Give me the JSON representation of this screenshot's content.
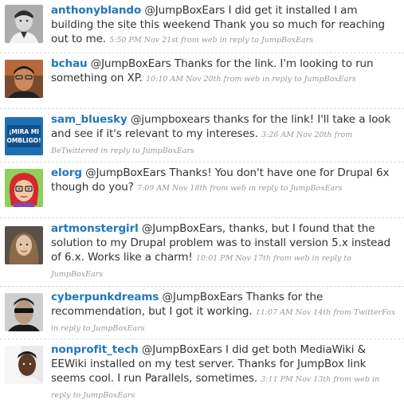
{
  "tweets": [
    {
      "username": "anthonyblando",
      "text": "@JumpBoxEars I did get it installed I am building the site this weekend Thank you so much for reaching out to me.",
      "time": "5:50 PM Nov 21st",
      "source": "from web",
      "reply": "in reply to JumpBoxEars",
      "avatar_icon": "grayscale-portrait-icon"
    },
    {
      "username": "bchau",
      "text": "@JumpBoxEars Thanks for the link. I'm looking to run something on XP.",
      "time": "10:10 AM Nov 20th",
      "source": "from web",
      "reply": "in reply to JumpBoxEars",
      "avatar_icon": "portrait-icon"
    },
    {
      "username": "sam_bluesky",
      "text": "@jumpboxears thanks for the link! I'll take a look and see if it's relevant to my intereses.",
      "time": "3:26 AM Nov 20th",
      "source": "from BeTwittered",
      "reply": "in reply to JumpBoxEars",
      "avatar_icon": "text-badge-icon",
      "avatar_text": [
        "¡MIRA MI",
        "OMBLIGO!"
      ]
    },
    {
      "username": "elorg",
      "text": "@JumpBoxEars Thanks! You don't have one for Drupal 6x though do you?",
      "time": "7:09 AM Nov 18th",
      "source": "from web",
      "reply": "in reply to JumpBoxEars",
      "avatar_icon": "cartoon-avatar-icon"
    },
    {
      "username": "artmonstergirl",
      "text": "@JumpBoxEars, thanks, but I found that the solution to my Drupal problem was to install version 5.x instead of 6.x. Works like a charm!",
      "time": "10:01 PM Nov 17th",
      "source": "from web",
      "reply": "in reply to JumpBoxEars",
      "avatar_icon": "portrait-icon"
    },
    {
      "username": "cyberpunkdreams",
      "text": "@JumpBoxEars Thanks for the recommendation, but I got it working.",
      "time": "11:07 AM Nov 14th",
      "source": "from TwitterFox",
      "reply": "in reply to JumpBoxEars",
      "avatar_icon": "sunglasses-portrait-icon"
    },
    {
      "username": "nonprofit_tech",
      "text": "@JumpBoxEars I did get both MediaWiki & EEWiki installed on my test server. Thanks for JumpBox link seems cool. I run Parallels, sometimes.",
      "time": "3:11 PM Nov 13th",
      "source": "from web",
      "reply": "in reply to JumpBoxEars",
      "avatar_icon": "portrait-icon"
    }
  ],
  "colors": {
    "username": "#2276bb",
    "text": "#333333",
    "meta": "#999999",
    "divider": "#d2dada"
  }
}
